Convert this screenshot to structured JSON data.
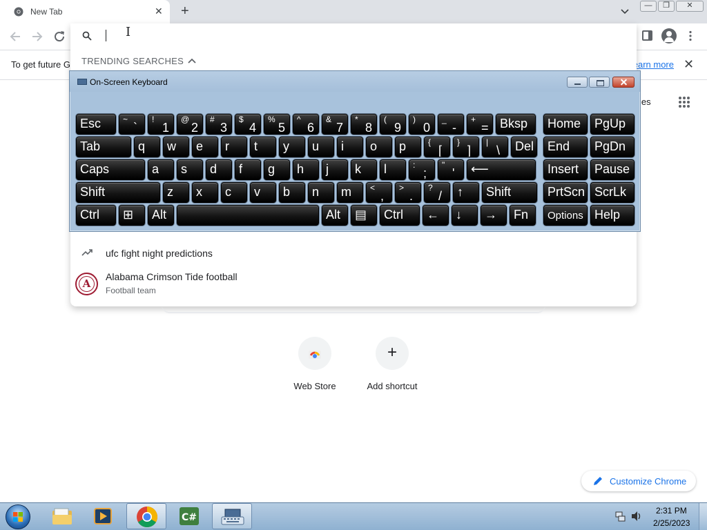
{
  "browser": {
    "tab_title": "New Tab",
    "tab_close": "✕",
    "new_tab": "+",
    "window_controls": {
      "minimize": "—",
      "restore": "❐",
      "close": "✕"
    }
  },
  "omnibox": {
    "value": "",
    "trending_header": "TRENDING SEARCHES",
    "suggestions": [
      {
        "title": "ufc fight night predictions",
        "icon": "trending-up-icon"
      },
      {
        "title": "Alabama Crimson Tide football",
        "subtitle": "Football team",
        "icon": "alabama-logo",
        "logo_letter": "A"
      }
    ]
  },
  "infobar": {
    "text": "To get future G",
    "link": "Learn more",
    "close": "✕"
  },
  "ntp": {
    "images_link": "Images",
    "shortcuts": [
      {
        "label": "Web Store",
        "icon": "chrome-web-store-icon"
      },
      {
        "label": "Add shortcut",
        "icon": "plus-icon",
        "glyph": "+"
      }
    ],
    "customize_label": "Customize Chrome"
  },
  "osk": {
    "title": "On-Screen Keyboard",
    "rows": [
      [
        {
          "l": "Esc"
        },
        {
          "s": "~",
          "p": "`"
        },
        {
          "s": "!",
          "p": "1"
        },
        {
          "s": "@",
          "p": "2"
        },
        {
          "s": "#",
          "p": "3"
        },
        {
          "s": "$",
          "p": "4"
        },
        {
          "s": "%",
          "p": "5"
        },
        {
          "s": "^",
          "p": "6"
        },
        {
          "s": "&",
          "p": "7"
        },
        {
          "s": "*",
          "p": "8"
        },
        {
          "s": "(",
          "p": "9"
        },
        {
          "s": ")",
          "p": "0"
        },
        {
          "s": "_",
          "p": "-"
        },
        {
          "s": "+",
          "p": "="
        },
        {
          "l": "Bksp"
        },
        {
          "l": "Home"
        },
        {
          "l": "PgUp"
        }
      ],
      [
        {
          "l": "Tab"
        },
        {
          "l": "q"
        },
        {
          "l": "w"
        },
        {
          "l": "e"
        },
        {
          "l": "r"
        },
        {
          "l": "t"
        },
        {
          "l": "y"
        },
        {
          "l": "u"
        },
        {
          "l": "i"
        },
        {
          "l": "o"
        },
        {
          "l": "p"
        },
        {
          "s": "{",
          "p": "["
        },
        {
          "s": "}",
          "p": "]"
        },
        {
          "s": "|",
          "p": "\\"
        },
        {
          "l": "Del"
        },
        {
          "l": "End"
        },
        {
          "l": "PgDn"
        }
      ],
      [
        {
          "l": "Caps"
        },
        {
          "l": "a"
        },
        {
          "l": "s"
        },
        {
          "l": "d"
        },
        {
          "l": "f"
        },
        {
          "l": "g"
        },
        {
          "l": "h"
        },
        {
          "l": "j"
        },
        {
          "l": "k"
        },
        {
          "l": "l"
        },
        {
          "s": ":",
          "p": ";"
        },
        {
          "s": "\"",
          "p": "'"
        },
        {
          "l": "⟵"
        },
        {
          "l": "Insert"
        },
        {
          "l": "Pause"
        }
      ],
      [
        {
          "l": "Shift"
        },
        {
          "l": "z"
        },
        {
          "l": "x"
        },
        {
          "l": "c"
        },
        {
          "l": "v"
        },
        {
          "l": "b"
        },
        {
          "l": "n"
        },
        {
          "l": "m"
        },
        {
          "s": "<",
          "p": ","
        },
        {
          "s": ">",
          "p": "."
        },
        {
          "s": "?",
          "p": "/"
        },
        {
          "l": "↑"
        },
        {
          "l": "Shift"
        },
        {
          "l": "PrtScn"
        },
        {
          "l": "ScrLk"
        }
      ],
      [
        {
          "l": "Ctrl"
        },
        {
          "l": "⊞"
        },
        {
          "l": "Alt"
        },
        {
          "l": ""
        },
        {
          "l": "Alt"
        },
        {
          "l": "▤"
        },
        {
          "l": "Ctrl"
        },
        {
          "l": "←"
        },
        {
          "l": "↓"
        },
        {
          "l": "→"
        },
        {
          "l": "Fn"
        },
        {
          "l": "Options",
          "small": true
        },
        {
          "l": "Help"
        }
      ]
    ]
  },
  "taskbar": {
    "items": [
      {
        "name": "explorer-taskbar-icon",
        "active": false
      },
      {
        "name": "media-player-taskbar-icon",
        "active": false
      },
      {
        "name": "chrome-taskbar-icon",
        "active": true
      },
      {
        "name": "csharp-taskbar-icon",
        "active": false
      },
      {
        "name": "osk-taskbar-icon",
        "active": true
      }
    ],
    "time": "2:31 PM",
    "date": "2/25/2023"
  },
  "colors": {
    "accent_link": "#1a73e8",
    "osk_frame": "#a8c2dc",
    "alabama": "#9e1b32"
  }
}
